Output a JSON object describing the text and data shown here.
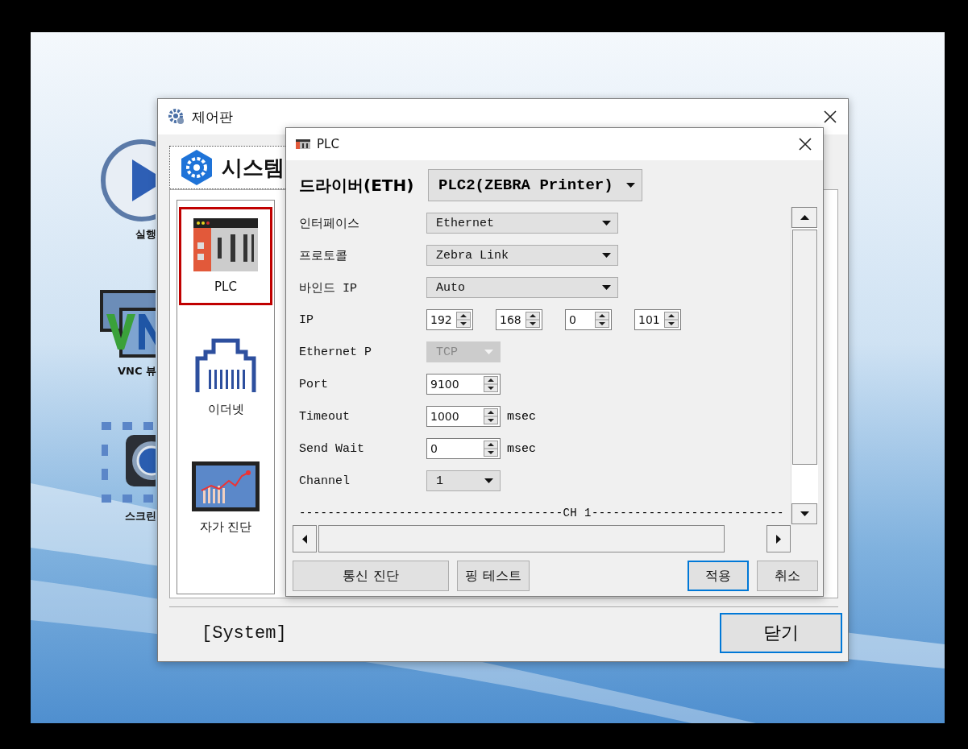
{
  "desktop_icons": [
    {
      "kind": "play",
      "label": "실행"
    },
    {
      "kind": "vnc",
      "label": "VNC 뷰"
    },
    {
      "kind": "camera",
      "label": "스크린"
    }
  ],
  "control_panel": {
    "title": "제어판",
    "tab": "시스템",
    "items": [
      {
        "kind": "plc",
        "label": "PLC",
        "selected": true
      },
      {
        "kind": "ethernet",
        "label": "이더넷",
        "selected": false
      },
      {
        "kind": "diagnosis",
        "label": "자가 진단",
        "selected": false
      }
    ],
    "footer": "[System]",
    "close_button": "닫기"
  },
  "plc_dialog": {
    "title": "PLC",
    "driver": {
      "label": "드라이버(ETH)",
      "value": "PLC2(ZEBRA Printer)"
    },
    "fields": [
      {
        "kind": "dropdown",
        "label": "인터페이스",
        "value": "Ethernet",
        "disabled": false,
        "wide": true
      },
      {
        "kind": "dropdown",
        "label": "프로토콜",
        "value": "Zebra Link",
        "disabled": false,
        "wide": true
      },
      {
        "kind": "dropdown",
        "label": "바인드 IP",
        "value": "Auto",
        "disabled": false,
        "wide": true
      },
      {
        "kind": "ip",
        "label": "IP",
        "parts": [
          "192",
          "168",
          "0",
          "101"
        ]
      },
      {
        "kind": "dropdown",
        "label": "Ethernet P",
        "value": "TCP",
        "disabled": true,
        "wide": false
      },
      {
        "kind": "spin",
        "label": "Port",
        "value": "9100"
      },
      {
        "kind": "spin",
        "label": "Timeout",
        "value": "1000",
        "unit": "msec"
      },
      {
        "kind": "spin",
        "label": "Send Wait",
        "value": "0",
        "unit": "msec"
      },
      {
        "kind": "dropdown",
        "label": "Channel",
        "value": "1",
        "disabled": false,
        "wide": false
      },
      {
        "kind": "separator",
        "label": "-------------------------------------CH 1---------------------------"
      }
    ],
    "buttons": [
      {
        "label": "통신 진단",
        "focused": false
      },
      {
        "label": "핑 테스트",
        "focused": false
      },
      {
        "label": "적용",
        "focused": true
      },
      {
        "label": "취소",
        "focused": false
      }
    ]
  }
}
